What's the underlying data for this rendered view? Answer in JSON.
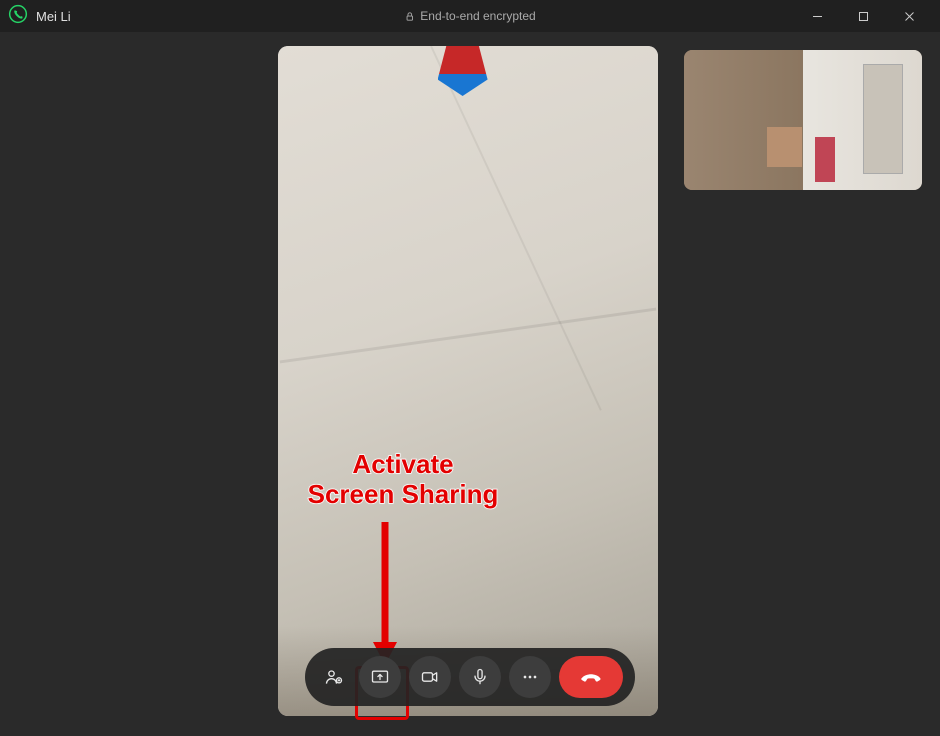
{
  "titlebar": {
    "contact_name": "Mei Li",
    "encryption_text": "End-to-end encrypted"
  },
  "annotation": {
    "line1": "Activate",
    "line2": "Screen Sharing"
  },
  "controls": {
    "participants": "participants",
    "screenshare": "screen-share",
    "video": "video",
    "mic": "microphone",
    "more": "more-options",
    "endcall": "end-call"
  }
}
